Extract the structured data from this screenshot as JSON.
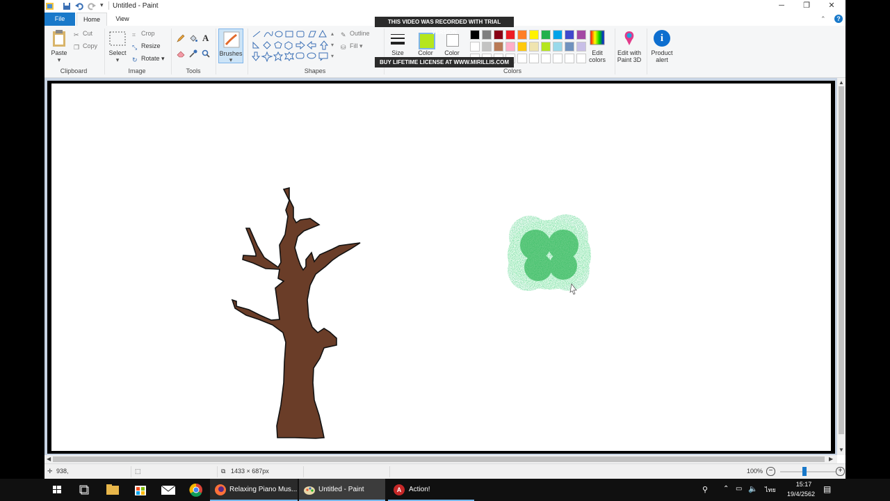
{
  "window": {
    "title": "Untitled - Paint"
  },
  "tabs": [
    {
      "label": "File"
    },
    {
      "label": "Home"
    },
    {
      "label": "View"
    }
  ],
  "ribbon": {
    "clipboard": {
      "paste": "Paste",
      "cut": "Cut",
      "copy": "Copy",
      "group": "Clipboard"
    },
    "image": {
      "select": "Select",
      "crop": "Crop",
      "resize": "Resize",
      "rotate": "Rotate",
      "group": "Image"
    },
    "tools": {
      "group": "Tools"
    },
    "brushes": {
      "label": "Brushes"
    },
    "shapes": {
      "outline": "Outline",
      "fill": "Fill",
      "group": "Shapes"
    },
    "size": {
      "label": "Size"
    },
    "color1": {
      "label": "Color"
    },
    "color2": {
      "label": "Color"
    },
    "colors": {
      "group": "Colors",
      "palette_row1": [
        "#000000",
        "#7f7f7f",
        "#880015",
        "#ed1c24",
        "#ff7f27",
        "#fff200",
        "#22b14c",
        "#00a2e8",
        "#3f48cc",
        "#a349a4"
      ],
      "palette_row2": [
        "#ffffff",
        "#c3c3c3",
        "#b97a57",
        "#ffaec9",
        "#ffc90e",
        "#efe4b0",
        "#b5e61d",
        "#99d9ea",
        "#7092be",
        "#c8bfe7"
      ],
      "edit_colors": "Edit colors"
    },
    "paint3d": {
      "label": "Edit with Paint 3D"
    },
    "product_alert": {
      "label": "Product alert"
    }
  },
  "watermark": {
    "top": "THIS VIDEO WAS RECORDED WITH TRIAL VERSION",
    "bottom": "BUY LIFETIME LICENSE AT WWW.MIRILLIS.COM"
  },
  "status": {
    "cursor": "938,",
    "size": "1433 × 687px",
    "zoom": "100%"
  },
  "taskbar": {
    "apps": [
      {
        "label": "Relaxing Piano Mus..."
      },
      {
        "label": "Untitled - Paint"
      },
      {
        "label": "Action!"
      }
    ],
    "lang": "ไทย",
    "time": "15:17",
    "date": "19/4/2562"
  },
  "colors": {
    "accent": "#1979ca",
    "tree_trunk": "#6a3d28",
    "bush": "#22b14c"
  }
}
